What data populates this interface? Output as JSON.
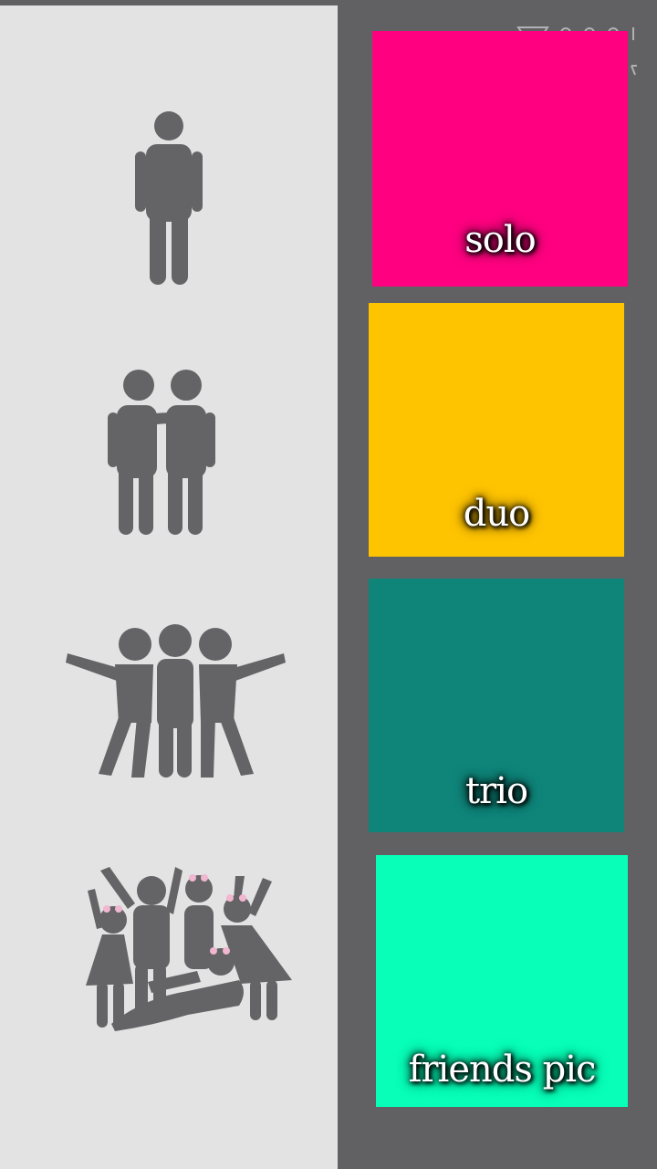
{
  "colors": {
    "panel_bg": "#e3e3e4",
    "frame_bg": "#616164",
    "icon_gray": "#646466",
    "solo": "#ff0080",
    "duo": "#ffc400",
    "trio": "#0f857a",
    "friends_pic": "#07ffb8"
  },
  "watermark": {
    "icon": "cut-scissors-icon"
  },
  "rows": [
    {
      "icon": "single-person-icon",
      "label": "solo"
    },
    {
      "icon": "two-friends-icon",
      "label": "duo"
    },
    {
      "icon": "three-friends-icon",
      "label": "trio"
    },
    {
      "icon": "group-of-friends-icon",
      "label": "friends pic"
    }
  ]
}
